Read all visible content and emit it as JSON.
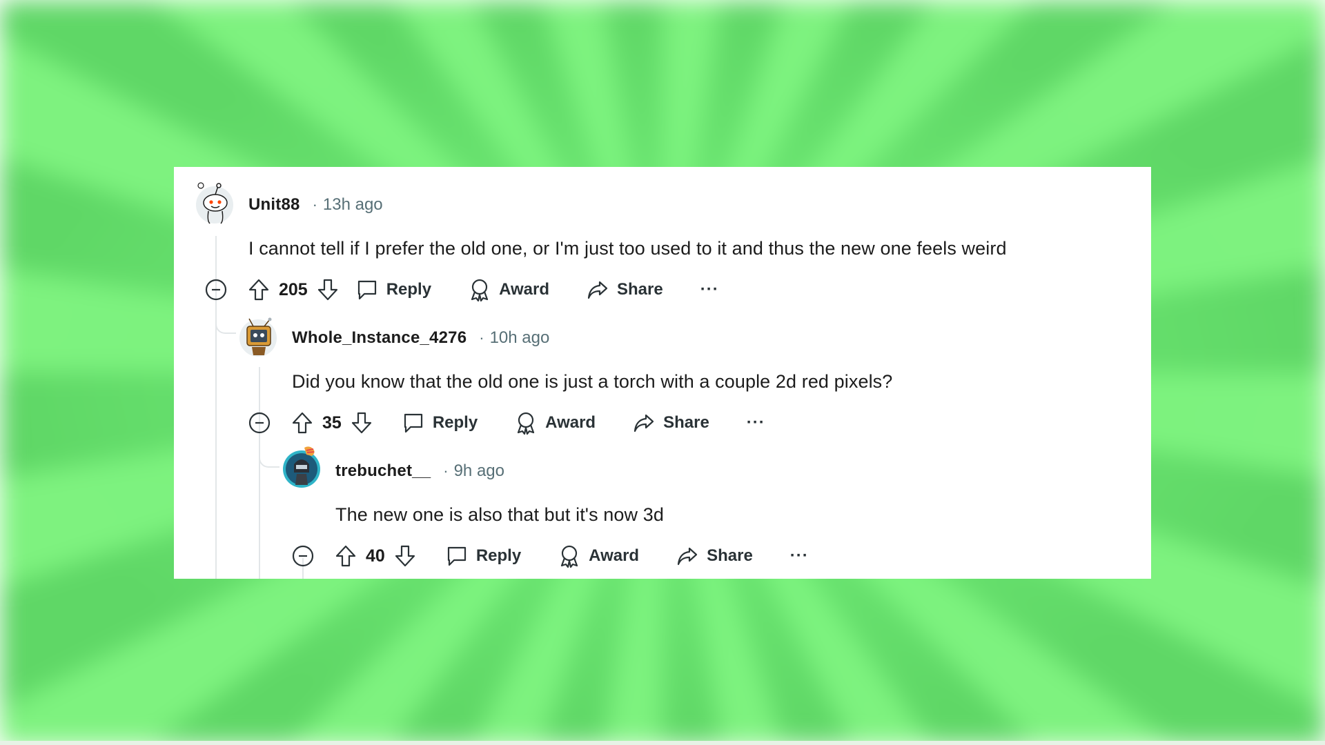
{
  "comments": [
    {
      "username": "Unit88",
      "separator": "·",
      "time": "13h ago",
      "text": "I cannot tell if I prefer the old one, or I'm just too used to it and thus the new one feels weird",
      "score": "205",
      "reply_label": "Reply",
      "award_label": "Award",
      "share_label": "Share",
      "more_label": "···"
    },
    {
      "username": "Whole_Instance_4276",
      "separator": "·",
      "time": "10h ago",
      "text": "Did you know that the old one is just a torch with a couple 2d red pixels?",
      "score": "35",
      "reply_label": "Reply",
      "award_label": "Award",
      "share_label": "Share",
      "more_label": "···"
    },
    {
      "username": "trebuchet__",
      "separator": "·",
      "time": "9h ago",
      "text": "The new one is also that but it's now 3d",
      "score": "40",
      "reply_label": "Reply",
      "award_label": "Award",
      "share_label": "Share",
      "more_label": "···"
    }
  ],
  "colors": {
    "background_green": "#6fe674",
    "card": "#ffffff",
    "text": "#1c1c1c",
    "meta": "#576f76",
    "thread_line": "#e2e6e8"
  }
}
